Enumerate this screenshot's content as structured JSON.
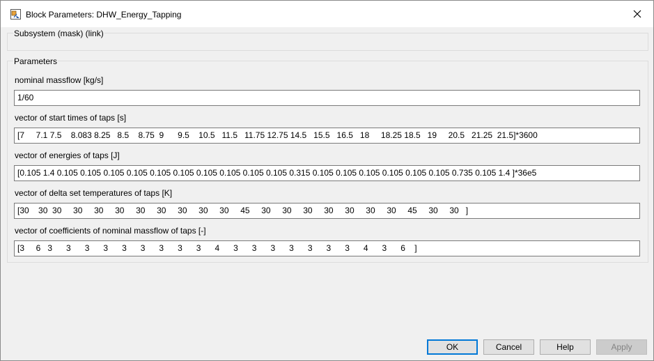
{
  "window": {
    "title": "Block Parameters: DHW_Energy_Tapping"
  },
  "subsystem": {
    "label": "Subsystem (mask) (link)"
  },
  "parameters": {
    "title": "Parameters",
    "fields": [
      {
        "label": "nominal massflow [kg/s]",
        "value": "1/60"
      },
      {
        "label": "vector of start times of taps [s]",
        "value": "[7     7.1 7.5    8.083 8.25   8.5    8.75  9      9.5    10.5   11.5   11.75 12.75 14.5   15.5   16.5   18     18.25 18.5   19     20.5   21.25  21.5]*3600"
      },
      {
        "label": "vector of energies of taps [J]",
        "value": "[0.105 1.4 0.105 0.105 0.105 0.105 0.105 0.105 0.105 0.105 0.105 0.105 0.315 0.105 0.105 0.105 0.105 0.105 0.105 0.735 0.105 1.4 ]*36e5"
      },
      {
        "label": "vector of delta set temperatures of taps [K]",
        "value": "[30    30  30     30     30     30     30     30     30     30     30     45     30     30     30     30     30     30     30     45     30     30   ]"
      },
      {
        "label": "vector of coefficients of nominal massflow of taps [-]",
        "value": "[3     6   3      3      3      3      3      3      3      3      3      4      3      3      3      3      3      3      3      4      3      6    ]"
      }
    ]
  },
  "buttons": {
    "ok": "OK",
    "cancel": "Cancel",
    "help": "Help",
    "apply": "Apply"
  },
  "colors": {
    "dialog_bg": "#f0f0f0",
    "focus_border": "#0078d7"
  }
}
